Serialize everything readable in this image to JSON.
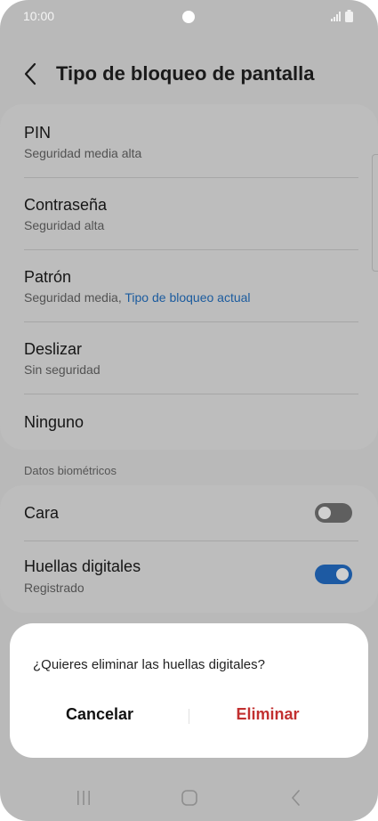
{
  "status_bar": {
    "time": "10:00"
  },
  "header": {
    "title": "Tipo de bloqueo de pantalla"
  },
  "lock_types": [
    {
      "title": "PIN",
      "subtitle": "Seguridad media alta"
    },
    {
      "title": "Contraseña",
      "subtitle": "Seguridad alta"
    },
    {
      "title": "Patrón",
      "subtitle": "Seguridad media, ",
      "subtitle_accent": "Tipo de bloqueo actual"
    },
    {
      "title": "Deslizar",
      "subtitle": "Sin seguridad"
    },
    {
      "title": "Ninguno"
    }
  ],
  "biometrics": {
    "section_label": "Datos biométricos",
    "items": [
      {
        "title": "Cara",
        "enabled": false
      },
      {
        "title": "Huellas digitales",
        "subtitle": "Registrado",
        "enabled": true
      }
    ]
  },
  "dialog": {
    "message": "¿Quieres eliminar las huellas digitales?",
    "cancel_label": "Cancelar",
    "confirm_label": "Eliminar"
  },
  "colors": {
    "accent": "#1d5aa3",
    "destructive": "#c23030",
    "dimmed_background": "#b9b9b9"
  },
  "nav_icons": [
    "recent-apps-icon",
    "home-icon",
    "back-icon"
  ]
}
